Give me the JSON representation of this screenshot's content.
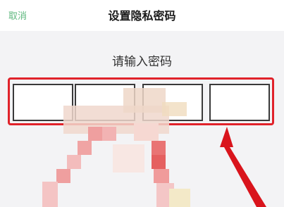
{
  "nav": {
    "cancel_label": "取消",
    "title": "设置隐私密码"
  },
  "prompt": "请输入密码",
  "pin": {
    "length": 4,
    "filled": 0
  },
  "colors": {
    "accent": "#5fb87f",
    "highlight": "#e0222a",
    "arrow": "#d9141c"
  },
  "icons": [
    "pointer-arrow-icon"
  ]
}
